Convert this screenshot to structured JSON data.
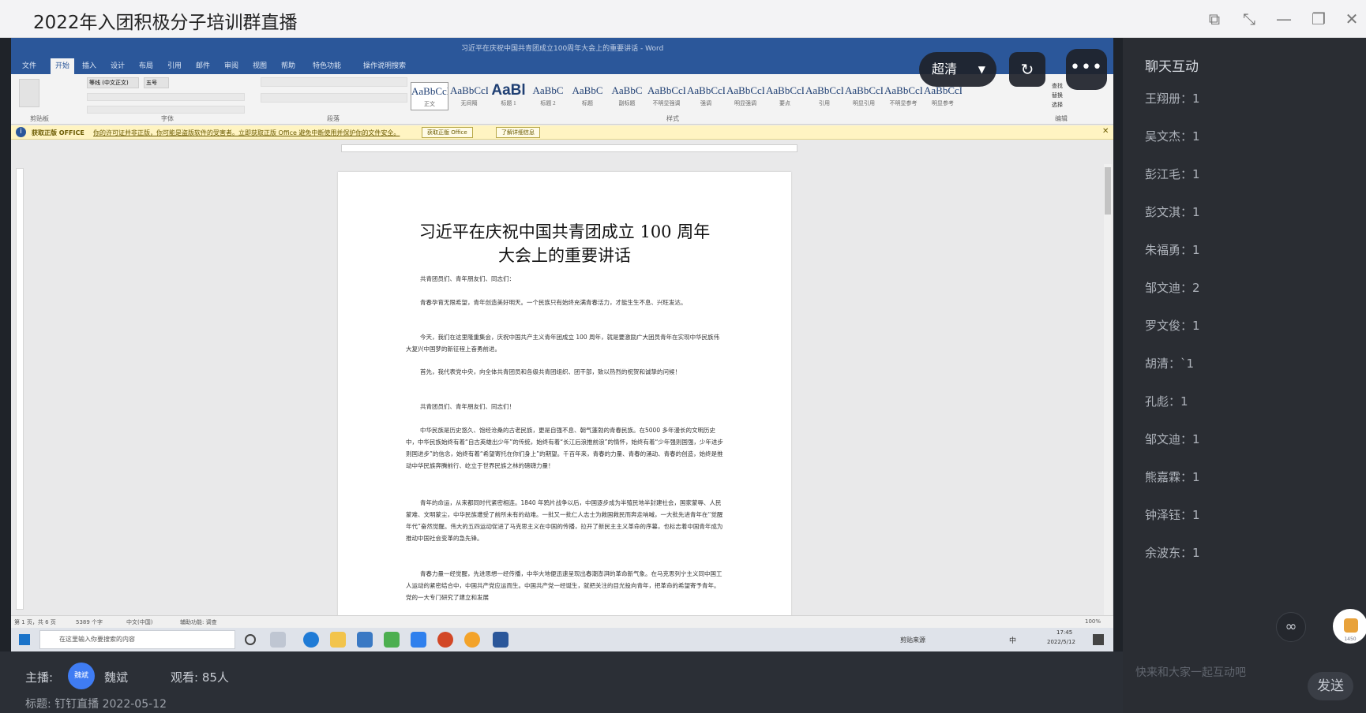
{
  "window": {
    "title": "2022年入团积极分子培训群直播"
  },
  "word": {
    "doc_title": "习近平在庆祝中国共青团成立100周年大会上的重要讲话 - Word",
    "tabs": [
      "文件",
      "开始",
      "插入",
      "设计",
      "布局",
      "引用",
      "邮件",
      "审阅",
      "视图",
      "帮助",
      "特色功能",
      "操作说明搜索"
    ],
    "font_name": "等线 (中文正文)",
    "font_size": "五号",
    "styles": [
      {
        "sample": "AaBbCcD",
        "name": "正文"
      },
      {
        "sample": "AaBbCcD",
        "name": "无间隔"
      },
      {
        "sample": "AaBl",
        "name": "标题 1"
      },
      {
        "sample": "AaBbC",
        "name": "标题 2"
      },
      {
        "sample": "AaBbC",
        "name": "标题"
      },
      {
        "sample": "AaBbC",
        "name": "副标题"
      },
      {
        "sample": "AaBbCcD",
        "name": "不明显强调"
      },
      {
        "sample": "AaBbCcD",
        "name": "强调"
      },
      {
        "sample": "AaBbCcD",
        "name": "明显强调"
      },
      {
        "sample": "AaBbCcD",
        "name": "要点"
      },
      {
        "sample": "AaBbCcD",
        "name": "引用"
      },
      {
        "sample": "AaBbCcD",
        "name": "明显引用"
      },
      {
        "sample": "AaBbCcD",
        "name": "不明显参考"
      },
      {
        "sample": "AaBbCcD",
        "name": "明显参考"
      }
    ],
    "groups": [
      "剪贴板",
      "字体",
      "段落",
      "样式",
      "编辑"
    ],
    "editing": [
      "查找",
      "替换",
      "选择"
    ],
    "notice": {
      "title": "获取正版 OFFICE",
      "text": "你的许可证并非正版，你可能是盗版软件的受害者。立即获取正版 Office 避免中断使用并保护你的文件安全。",
      "btn1": "获取正版 Office",
      "btn2": "了解详细信息"
    },
    "doc": {
      "heading_line1": "习近平在庆祝中国共青团成立 100 周年",
      "heading_line2": "大会上的重要讲话",
      "paragraphs": [
        "共青团员们、青年朋友们、同志们：",
        "青春孕育无限希望，青年创造美好明天。一个民族只有始终充满青春活力，才能生生不息、兴旺发达。",
        "今天，我们在这里隆重集会，庆祝中国共产主义青年团成立 100 周年，就是要激励广大团员青年在实现中华民族伟大复兴中国梦的新征程上奋勇前进。",
        "首先，我代表党中央，向全体共青团员和各级共青团组织、团干部，致以热烈的祝贺和诚挚的问候！",
        "共青团员们、青年朋友们、同志们！",
        "中华民族是历史悠久、饱经沧桑的古老民族，更是自强不息、朝气蓬勃的青春民族。在5000 多年漫长的文明历史中，中华民族始终有着“自古英雄出少年”的传统，始终有着“长江后浪推前浪”的情怀，始终有着“少年强则国强，少年进步则国进步”的信念，始终有着“希望寄托在你们身上”的期望。千百年来，青春的力量、青春的涌动、青春的创造，始终是推动中华民族奔腾前行、屹立于世界民族之林的磅礴力量！",
        "青年的命运，从来都同时代紧密相连。1840 年鸦片战争以后，中国逐步成为半殖民地半封建社会，国家蒙辱、人民蒙难、文明蒙尘，中华民族遭受了前所未有的劫难。一批又一批仁人志士为救国救民而奔走呐喊，一大批先进青年在“觉醒年代”奋然觉醒。伟大的五四运动促进了马克思主义在中国的传播，拉开了新民主主义革命的序幕，也标志着中国青年成为推动中国社会变革的急先锋。",
        "青春力量一经觉醒，先进思想一经传播，中华大地便迅速呈现出春潮澎湃的革命新气象。在马克思列宁主义同中国工人运动的紧密结合中，中国共产党应运而生。中国共产党一经诞生，就把关注的目光投向青年，把革命的希望寄予青年。党的一大专门研究了建立和发展"
      ]
    },
    "status": {
      "page": "第 1 页，共 6 页",
      "words": "5389 个字",
      "lang": "中文(中国)",
      "accessibility": "辅助功能: 调查",
      "zoom": "100%"
    },
    "taskbar": {
      "search_placeholder": "在这里输入你要搜索的内容",
      "tray_text": "剪贴来源",
      "ime": "中",
      "time": "17:45",
      "date": "2022/5/12"
    }
  },
  "stream": {
    "quality": "超清"
  },
  "chat": {
    "header": "聊天互动",
    "messages": [
      "王翔册：1",
      "吴文杰：1",
      "彭江毛：1",
      "彭文淇：1",
      "朱福勇：1",
      "邹文迪：2",
      "罗文俊：1",
      "胡清：`1",
      "孔彪：1",
      "邹文迪：1",
      "熊嘉霖：1",
      "钟泽钰：1",
      "余波东：1"
    ],
    "viewer_badge": "1450",
    "input_placeholder": "快来和大家一起互动吧",
    "send_label": "发送"
  },
  "bottom": {
    "host_label": "主播:",
    "host_avatar_text": "魏斌",
    "host_name": "魏斌",
    "viewers": "观看: 85人",
    "subject": "标题: 钉钉直播 2022-05-12"
  }
}
